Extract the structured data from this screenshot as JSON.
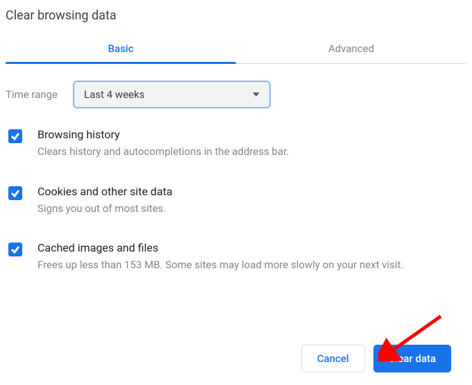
{
  "title": "Clear browsing data",
  "tabs": {
    "basic": "Basic",
    "advanced": "Advanced"
  },
  "range": {
    "label": "Time range",
    "selected": "Last 4 weeks"
  },
  "options": [
    {
      "title": "Browsing history",
      "desc": "Clears history and autocompletions in the address bar."
    },
    {
      "title": "Cookies and other site data",
      "desc": "Signs you out of most sites."
    },
    {
      "title": "Cached images and files",
      "desc": "Frees up less than 153 MB. Some sites may load more slowly on your next visit."
    }
  ],
  "buttons": {
    "cancel": "Cancel",
    "clear": "Clear data"
  }
}
